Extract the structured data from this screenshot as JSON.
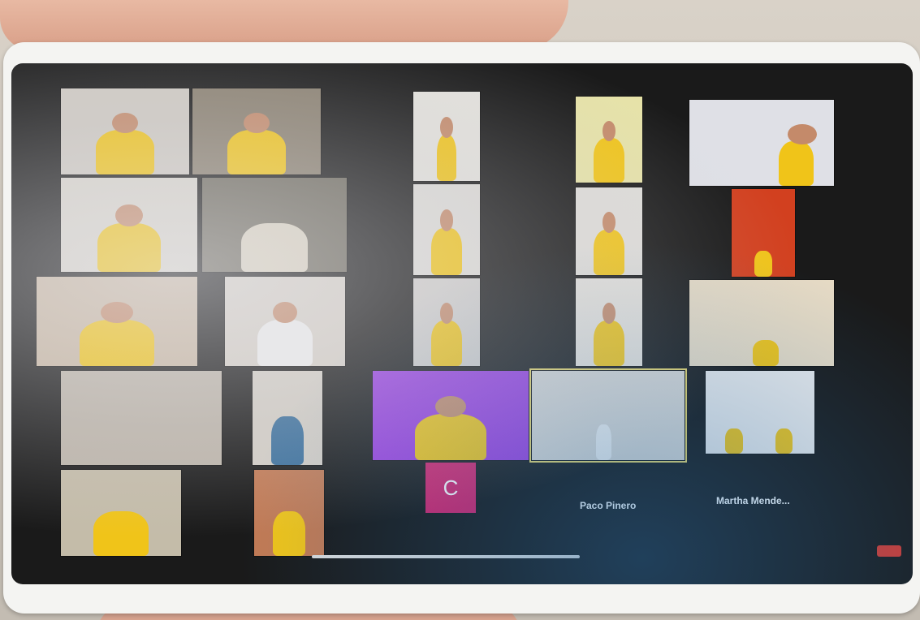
{
  "meeting": {
    "caller_initial": "C",
    "names": {
      "top_right": "Paco Pinero",
      "bottom_right": "Martha Mende..."
    }
  },
  "colors": {
    "shirt": "#f0c419",
    "avatar_bg": "#d4246c",
    "purple_bg": "#9b3fe0",
    "active_border": "#e8d66a",
    "leave": "#d63a2f"
  }
}
